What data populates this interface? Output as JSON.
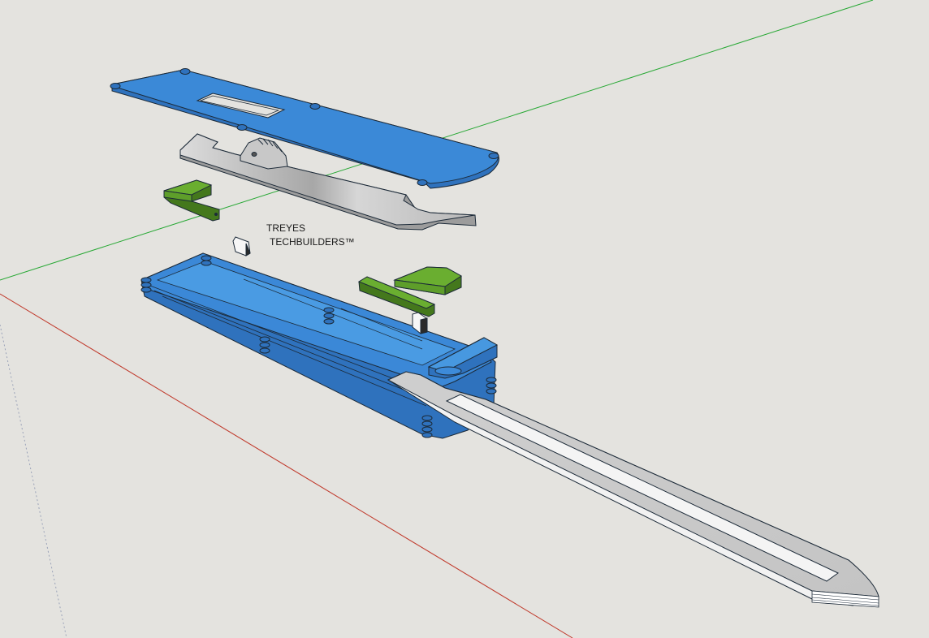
{
  "watermark": {
    "line1": "TREYES",
    "line2": "TECHBUILDERS™"
  },
  "colors": {
    "background": "#e4e3df",
    "blue_part": "#3d8bd9",
    "blue_part_dark": "#2f72bd",
    "green_part": "#5e9e2a",
    "green_part_dark": "#44781c",
    "metal_light": "#d9d9d9",
    "metal_dark": "#9c9c9c",
    "axis_red": "#c0392b",
    "axis_green": "#27a834",
    "edge": "#1c2a38"
  },
  "parts": [
    "top-cover-plate",
    "metal-slider-plate",
    "green-lever-left",
    "small-spacer-block",
    "bottom-housing",
    "green-cap-right",
    "green-lever-bar-right",
    "small-clip-block",
    "blue-lock-tab",
    "hidden-blade"
  ]
}
